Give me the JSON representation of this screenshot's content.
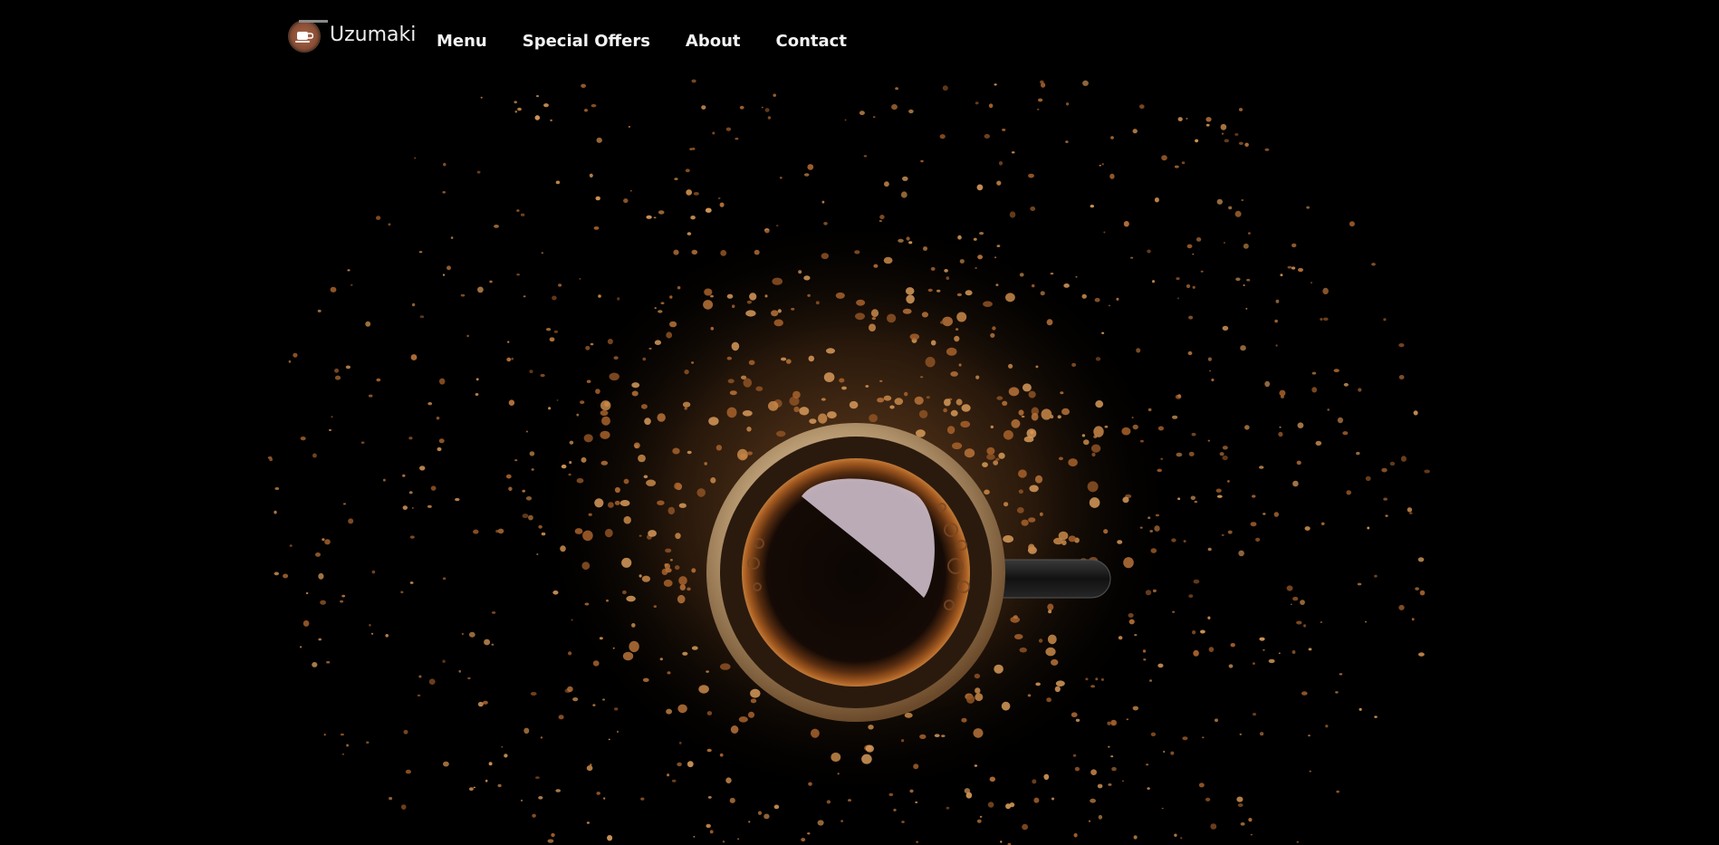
{
  "brand": {
    "name": "Uzumaki",
    "logo_icon": "coffee-cup-icon"
  },
  "nav": {
    "items": [
      {
        "label": "Menu"
      },
      {
        "label": "Special Offers"
      },
      {
        "label": "About"
      },
      {
        "label": "Contact"
      }
    ]
  },
  "hero": {
    "image": "coffee-cup-with-grounds",
    "colors": {
      "background": "#000000",
      "grounds": "#b8733a",
      "rim": "#cdb89a",
      "crema": "#8a4a1a"
    }
  }
}
